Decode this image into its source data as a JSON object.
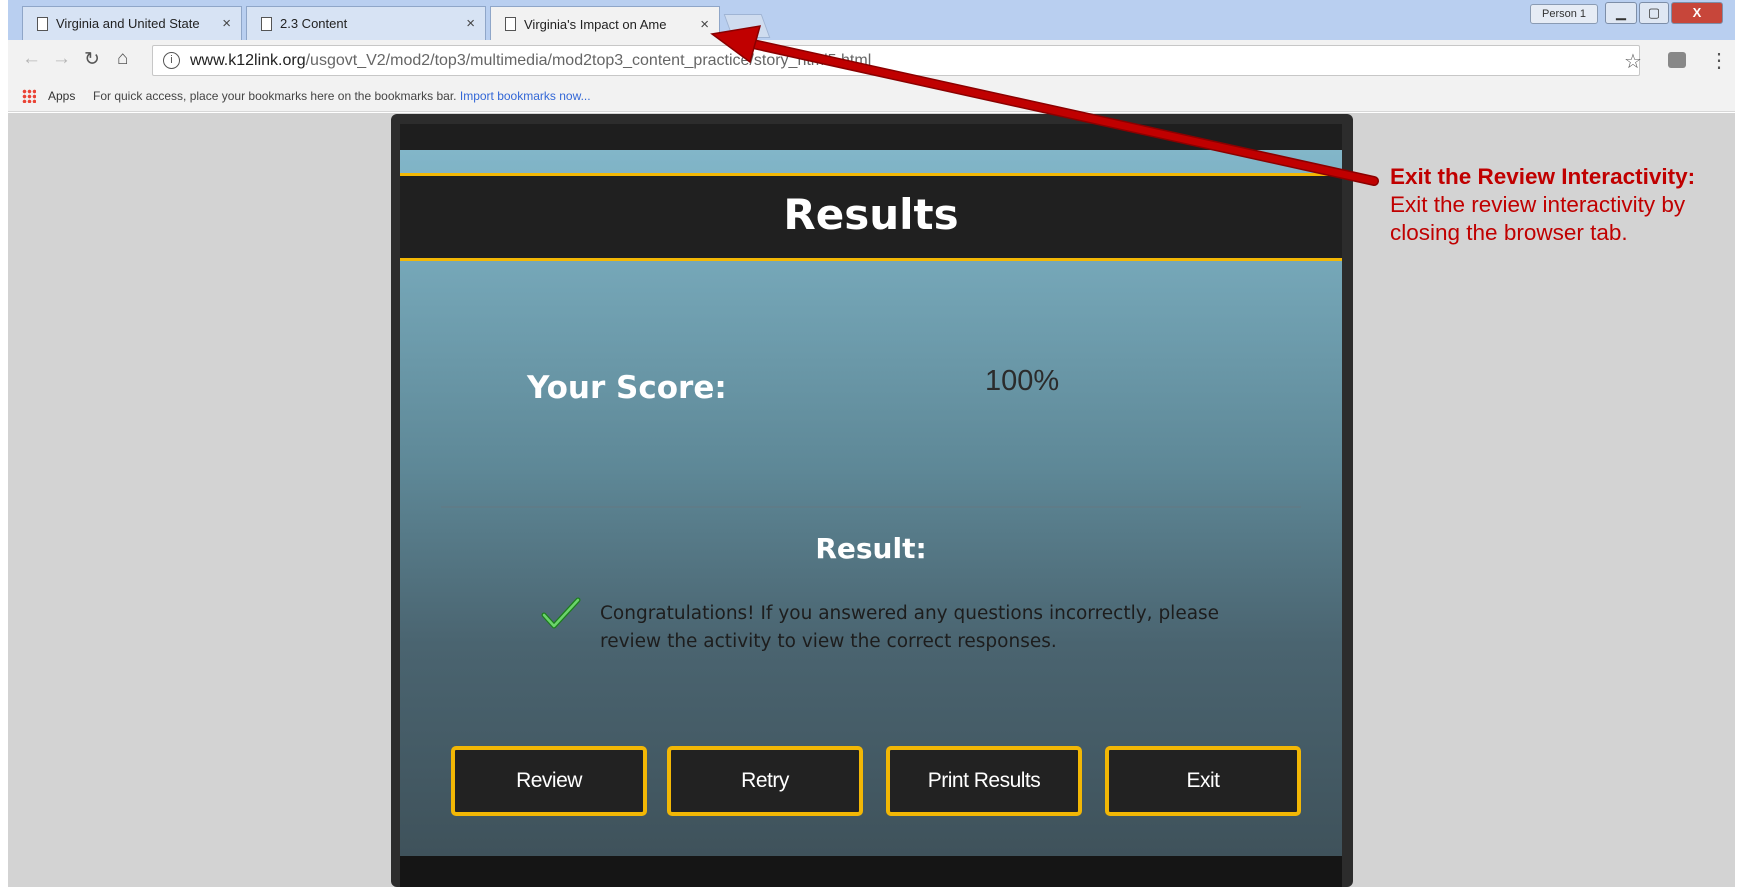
{
  "browser": {
    "tabs": [
      {
        "title": "Virginia and United State",
        "active": false
      },
      {
        "title": "2.3 Content",
        "active": false
      },
      {
        "title": "Virginia's Impact on Ame",
        "active": true
      }
    ],
    "tab_close_glyph": "×",
    "profile_label": "Person 1",
    "window_buttons": {
      "minimize": "▁",
      "maximize": "▢",
      "close": "X"
    },
    "url": {
      "host": "www.k12link.org",
      "path": "/usgovt_V2/mod2/top3/multimedia/mod2top3_content_practice/story_html5.html"
    },
    "bookmarks_bar": {
      "apps_label": "Apps",
      "hint": "For quick access, place your bookmarks here on the bookmarks bar.",
      "import_link": "Import bookmarks now..."
    }
  },
  "slide": {
    "title": "Results",
    "score_label": "Your Score:",
    "score_value": "100%",
    "result_label": "Result:",
    "message": "Congratulations! If you answered any questions incorrectly, please review the activity to view the correct responses.",
    "buttons": {
      "review": "Review",
      "retry": "Retry",
      "print": "Print Results",
      "exit": "Exit"
    }
  },
  "annotation": {
    "heading": "Exit the Review Interactivity:",
    "body": "Exit the review interactivity by closing the browser tab.",
    "color": "#c00000"
  },
  "colors": {
    "accent_gold": "#f2b705",
    "header_dark": "#202020",
    "arrow_red": "#c00000"
  }
}
